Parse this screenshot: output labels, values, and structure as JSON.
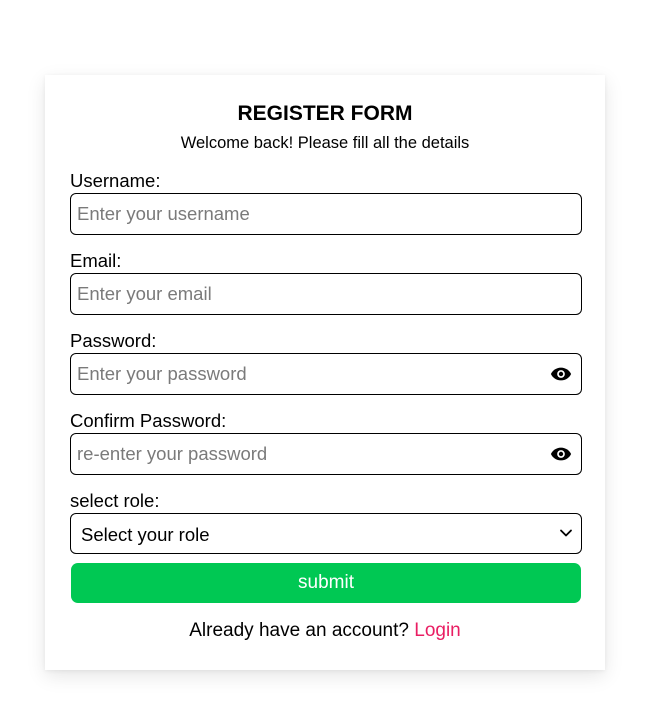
{
  "form": {
    "title": "REGISTER FORM",
    "subtitle": "Welcome back! Please fill all the details",
    "username": {
      "label": "Username:",
      "placeholder": "Enter your username"
    },
    "email": {
      "label": "Email:",
      "placeholder": "Enter your email"
    },
    "password": {
      "label": "Password:",
      "placeholder": "Enter your password",
      "toggle_icon": "eye-icon"
    },
    "confirm_password": {
      "label": "Confirm Password:",
      "placeholder": "re-enter your password",
      "toggle_icon": "eye-icon"
    },
    "role": {
      "label": "select role:",
      "selected": "Select your role",
      "icon": "chevron-down-icon"
    },
    "submit_label": "submit",
    "footer_text": "Already have an account?",
    "login_link": "Login"
  },
  "colors": {
    "submit_bg": "#00c853",
    "link": "#e91e63",
    "border": "#000000",
    "placeholder": "#7a7a7a"
  }
}
